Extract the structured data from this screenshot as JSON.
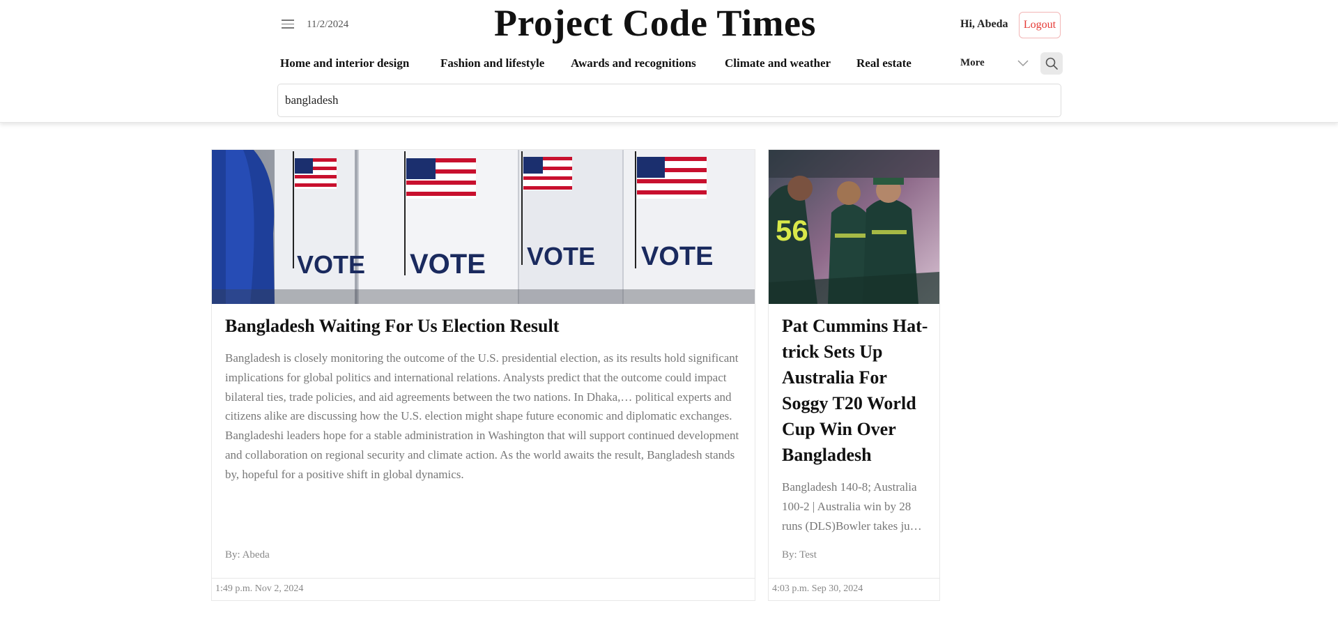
{
  "header": {
    "date": "11/2/2024",
    "site_title": "Project Code Times",
    "greeting": "Hi, Abeda",
    "logout_label": "Logout"
  },
  "nav": {
    "items": [
      "Home and interior design",
      "Fashion and lifestyle",
      "Awards and recognitions",
      "Climate and weather",
      "Real estate"
    ],
    "more_label": "More"
  },
  "search": {
    "value": "bangladesh"
  },
  "articles": [
    {
      "title": "Bangladesh Waiting For Us Election Result",
      "excerpt": "Bangladesh is closely monitoring the outcome of the U.S. presidential election, as its results hold significant implications for global politics and international relations. Analysts predict that the outcome could impact bilateral ties, trade policies, and aid agreements between the two nations. In Dhaka,… political experts and citizens alike are discussing how the U.S. election might shape future economic and diplomatic exchanges. Bangladeshi leaders hope for a stable administration in Washington that will support continued development and collaboration on regional security and climate action. As the world awaits the result, Bangladesh stands by, hopeful for a positive shift in global dynamics.",
      "author": "By: Abeda",
      "timestamp": "1:49 p.m. Nov 2, 2024",
      "image_text": "VOTE"
    },
    {
      "title": "Pat Cummins Hat-trick Sets Up Australia For Soggy T20 World Cup Win Over Bangladesh",
      "excerpt": "Bangladesh 140-8; Australia 100-2 | Australia win by 28 runs (DLS)Bowler takes ju…",
      "author": "By: Test",
      "timestamp": "4:03 p.m. Sep 30, 2024",
      "image_text": "56"
    }
  ],
  "colors": {
    "accent_red": "#e53935",
    "muted_text": "#777777"
  }
}
